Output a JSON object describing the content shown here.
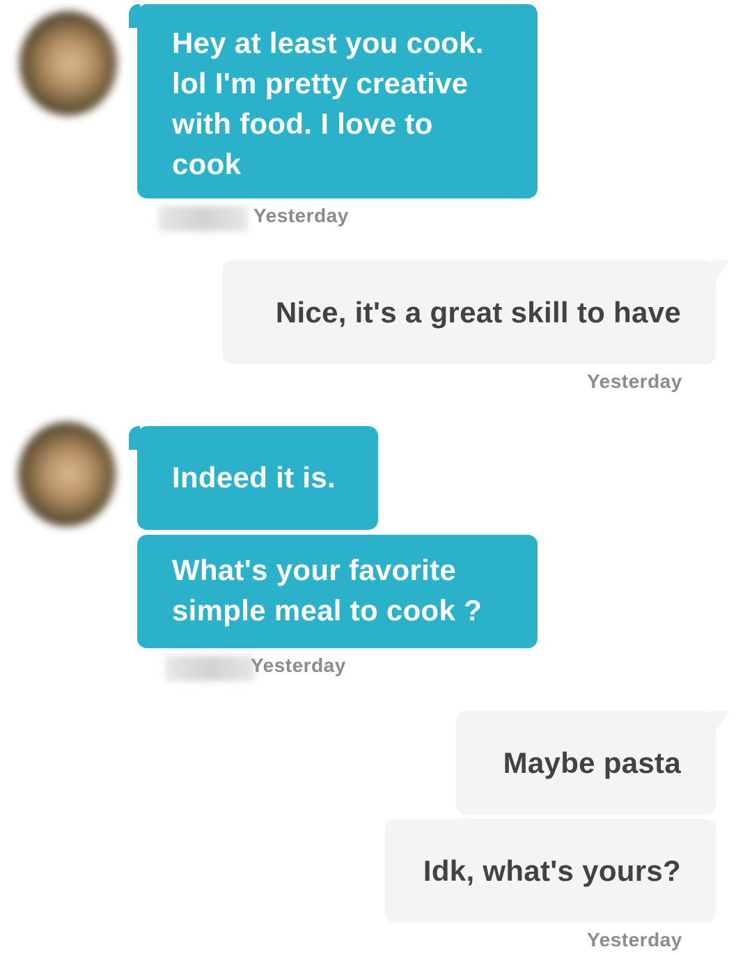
{
  "messages": [
    {
      "text_lines": [
        "Hey at least you cook.",
        "lol I'm pretty creative",
        "with food. I love to",
        "cook"
      ],
      "timestamp": "Yesterday"
    },
    {
      "text": "Nice, it's a great skill to have",
      "timestamp": "Yesterday"
    },
    {
      "text": "Indeed it is."
    },
    {
      "text_lines": [
        "What's your favorite",
        "simple meal to cook ?"
      ],
      "timestamp": "Yesterday"
    },
    {
      "text": "Maybe pasta"
    },
    {
      "text": "Idk, what's yours?",
      "timestamp": "Yesterday"
    }
  ],
  "colors": {
    "incoming_bubble": "#2bb2ca",
    "outgoing_bubble": "#f4f4f4",
    "incoming_text": "#ffffff",
    "outgoing_text": "#424242",
    "timestamp": "#8c8c8c"
  }
}
